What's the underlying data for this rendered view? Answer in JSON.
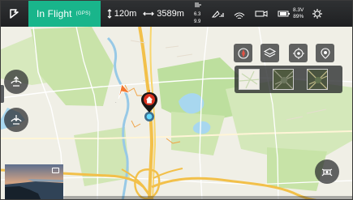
{
  "status_bar": {
    "logo_icon": "drone-home-logo",
    "flight_status": "In Flight",
    "positioning_mode": "(GPS)",
    "status_color": "#19b58b",
    "altitude": "120m",
    "distance": "3589m",
    "horizontal_speed": "6.3",
    "vertical_speed": "9.9",
    "battery_voltage": "8.3V",
    "battery_percent": "89%",
    "icons": [
      "altitude-icon",
      "distance-icon",
      "speed-icon",
      "gps-signal-icon",
      "remote-signal-icon",
      "video-signal-icon",
      "battery-icon",
      "settings-gear-icon"
    ]
  },
  "left_controls": {
    "takeoff_icon": "takeoff-landing-icon",
    "return_icon": "return-to-home-icon"
  },
  "map_tools": {
    "icons": [
      "compass-icon",
      "layers-icon",
      "locate-icon",
      "drone-location-icon"
    ],
    "map_types": [
      "standard-map-thumb",
      "satellite-map-thumb",
      "hybrid-map-thumb"
    ]
  },
  "drone_button_icon": "drone-icon"
}
